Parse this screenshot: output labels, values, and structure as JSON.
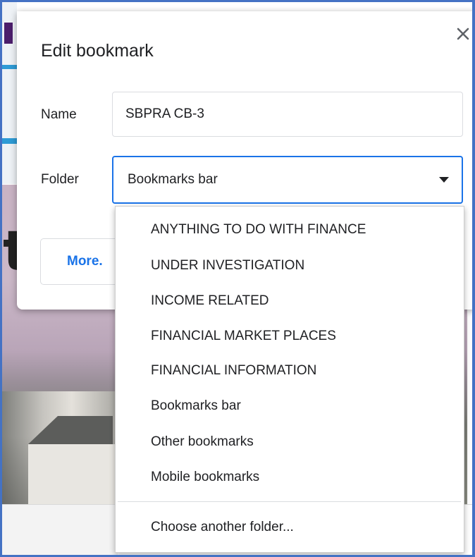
{
  "dialog": {
    "title": "Edit bookmark",
    "name_label": "Name",
    "name_value": "SBPRA CB-3",
    "folder_label": "Folder",
    "folder_selected": "Bookmarks bar",
    "more_button": "More.",
    "close_icon": "close-icon"
  },
  "folder_menu": {
    "options": [
      "ANYTHING TO DO WITH FINANCE",
      "UNDER INVESTIGATION",
      "INCOME RELATED",
      "FINANCIAL MARKET PLACES",
      "FINANCIAL INFORMATION",
      "Bookmarks bar",
      "Other bookmarks",
      "Mobile bookmarks"
    ],
    "choose_other": "Choose another folder..."
  },
  "background": {
    "partial_letter": "t"
  },
  "colors": {
    "accent": "#1a73e8",
    "text": "#202124",
    "frame": "#4472c4"
  }
}
